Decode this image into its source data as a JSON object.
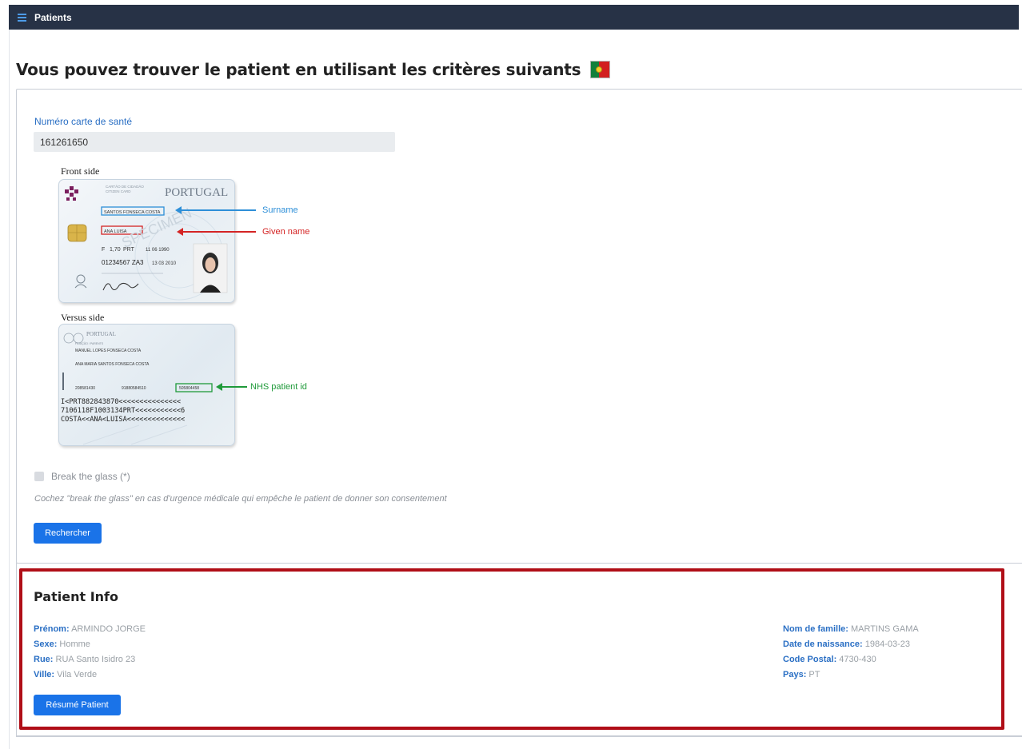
{
  "navbar": {
    "title": "Patients"
  },
  "page": {
    "heading": "Vous pouvez trouver le patient en utilisant les critères suivants"
  },
  "search": {
    "field_label": "Numéro carte de santé",
    "field_value": "161261650",
    "front_label": "Front side",
    "back_label": "Versus side",
    "front_card": {
      "title_small": "CARTÃO DE CIDADÃO",
      "title_small2": "CITIZEN CARD",
      "country": "PORTUGAL",
      "surname": "SANTOS FONSECA COSTA",
      "given_name": "ANA LUISA",
      "sex": "F",
      "height": "1,70",
      "nationality": "PRT",
      "birth_date": "11 06 1990",
      "doc_number": "01234567 ZA3",
      "expiry": "13 03 2010",
      "watermark": "SPECIMEN"
    },
    "back_card": {
      "country": "PORTUGAL",
      "parents_label": "FILIAÇÃO / PARENTS",
      "parent1": "MANUEL LOPES FONSECA COSTA",
      "parent2": "ANA MARIA SANTOS FONSECA COSTA",
      "tax_no": "208581430",
      "social_no": "91880584510",
      "nhs_no": "505804458",
      "mrz1": "I<PRT882843870<<<<<<<<<<<<<<<",
      "mrz2": "7106118F1003134PRT<<<<<<<<<<<6",
      "mrz3": "COSTA<<ANA<LUISA<<<<<<<<<<<<<<"
    },
    "annotations": {
      "surname": "Surname",
      "given_name": "Given name",
      "nhs_id": "NHS patient id"
    },
    "annotation_colors": {
      "surname": "#2e8fd8",
      "given_name": "#d42424",
      "nhs_id": "#1f9a3a"
    },
    "break_glass_label": "Break the glass (*)",
    "break_glass_checked": false,
    "help_text": "Cochez \"break the glass\" en cas d'urgence médicale qui empêche le patient de donner son consentement",
    "search_button": "Rechercher"
  },
  "patient": {
    "title": "Patient Info",
    "left": [
      {
        "key": "Prénom:",
        "value": "ARMINDO JORGE"
      },
      {
        "key": "Sexe:",
        "value": "Homme"
      },
      {
        "key": "Rue:",
        "value": "RUA Santo Isidro 23"
      },
      {
        "key": "Ville:",
        "value": "Vila Verde"
      }
    ],
    "right": [
      {
        "key": "Nom de famille:",
        "value": "MARTINS GAMA"
      },
      {
        "key": "Date de naissance:",
        "value": "1984-03-23"
      },
      {
        "key": "Code Postal:",
        "value": "4730-430"
      },
      {
        "key": "Pays:",
        "value": "PT"
      }
    ],
    "summary_button": "Résumé Patient"
  },
  "colors": {
    "navbar": "#273246",
    "primary": "#1a73e8",
    "highlight": "#b00e17",
    "label_blue": "#2a6fc4"
  }
}
